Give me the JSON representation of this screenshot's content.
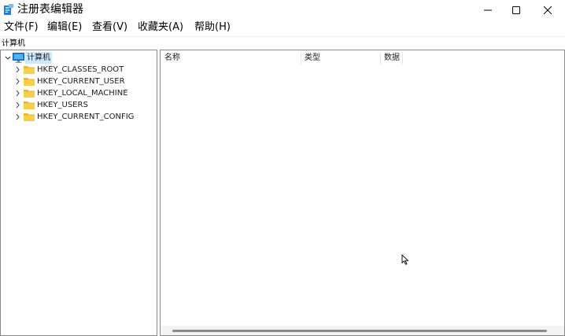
{
  "window": {
    "title": "注册表编辑器"
  },
  "menu": [
    "文件(F)",
    "编辑(E)",
    "查看(V)",
    "收藏夹(A)",
    "帮助(H)"
  ],
  "address_bar": {
    "path": "计算机"
  },
  "tree": {
    "root": "计算机",
    "children": [
      "HKEY_CLASSES_ROOT",
      "HKEY_CURRENT_USER",
      "HKEY_LOCAL_MACHINE",
      "HKEY_USERS",
      "HKEY_CURRENT_CONFIG"
    ]
  },
  "list": {
    "columns": [
      "名称",
      "类型",
      "数据"
    ]
  },
  "colors": {
    "selection": "#cce8ff",
    "folder": "#f8cf4a",
    "folder_dark": "#e8b32e",
    "monitor": "#1e88d6"
  }
}
